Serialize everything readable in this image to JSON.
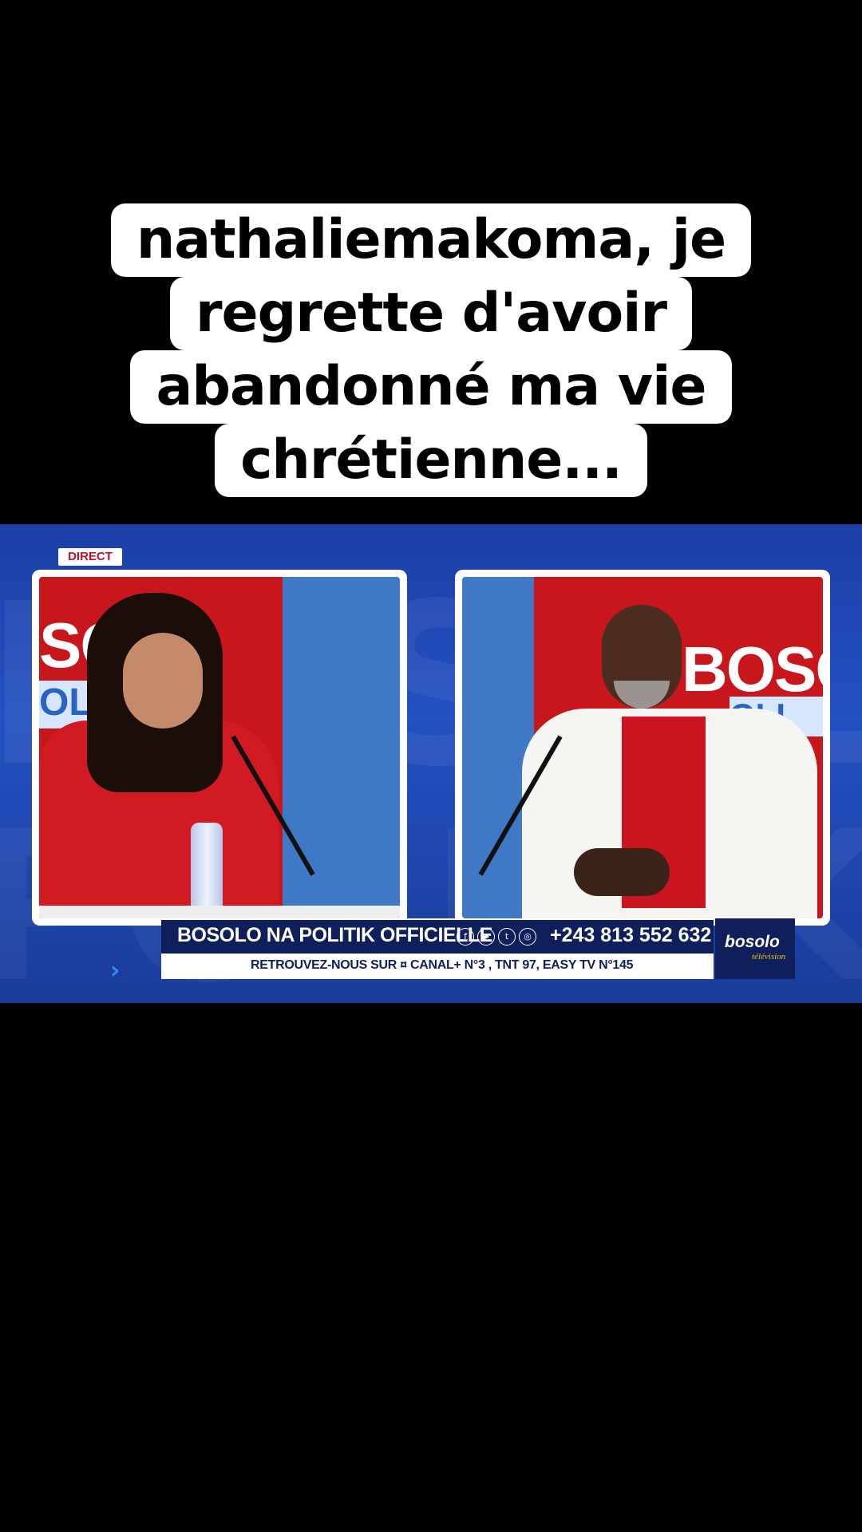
{
  "caption": {
    "lines": [
      "nathaliemakoma, je",
      "regrette d'avoir",
      "abandonné ma vie",
      "chrétienne..."
    ]
  },
  "broadcast": {
    "live_badge": "DIRECT",
    "show_logo_left": "SOL",
    "show_logo_left_sub": "OLI",
    "show_logo_right": "BOSO",
    "show_logo_right_sub": "OLI",
    "lower_third": {
      "title": "BOSOLO NA POLITIK OFFICIELLE",
      "social_icons": [
        "f",
        "▶",
        "t",
        "◎"
      ],
      "phone": "+243 813 552 632",
      "ticker": "RETROUVEZ-NOUS SUR ¤ CANAL+ N°3 , TNT 97, EASY TV N°145"
    },
    "channel_logo": {
      "name": "bosolo",
      "sub": "télévision"
    },
    "arrow": "›",
    "bg_text": "BOSOLO",
    "bg_text2": "POLITIK"
  }
}
